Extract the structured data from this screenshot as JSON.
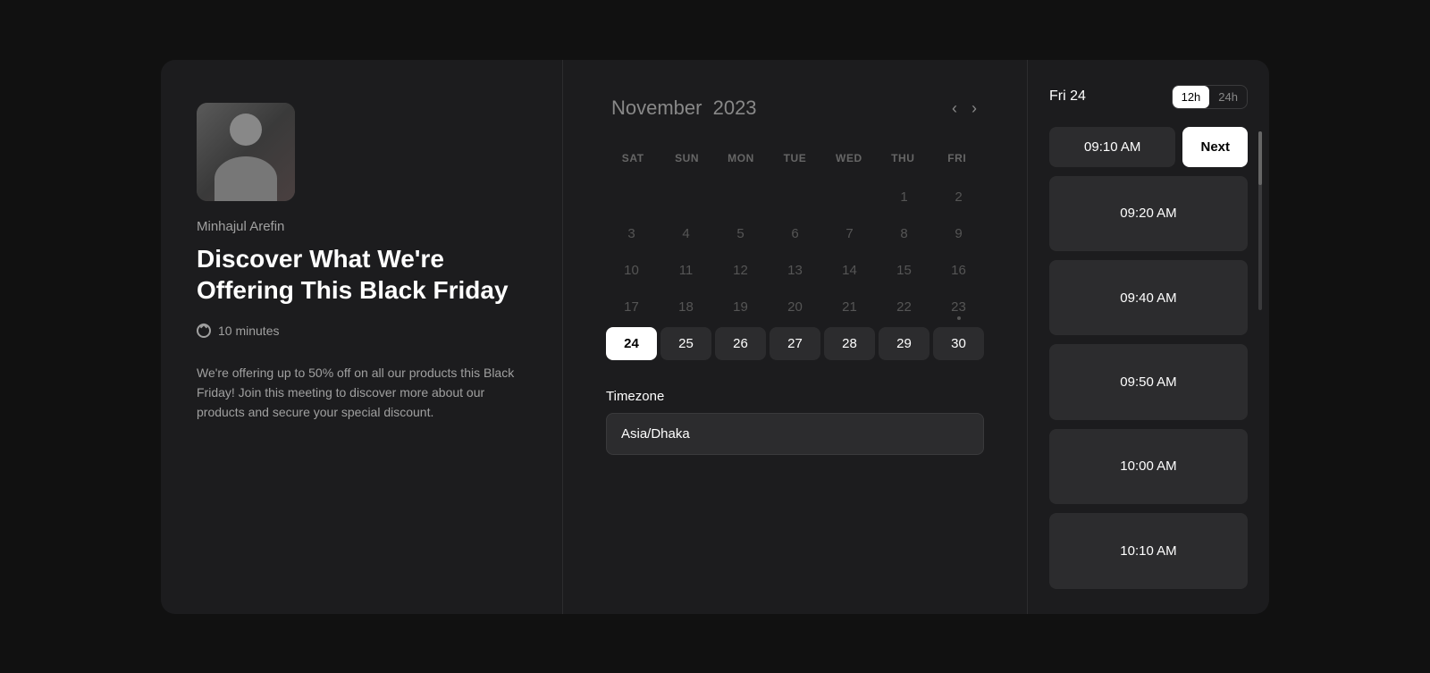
{
  "left": {
    "host_name": "Minhajul Arefin",
    "event_title_line1": "Discover What We're",
    "event_title_line2": "Offering This Black Friday",
    "duration": "10 minutes",
    "description": "We're offering up to 50% off on all our products this Black Friday! Join this meeting to discover more about our products and secure your special discount."
  },
  "calendar": {
    "month": "November",
    "year": "2023",
    "prev_label": "‹",
    "next_label": "›",
    "day_headers": [
      "SAT",
      "SUN",
      "MON",
      "TUE",
      "WED",
      "THU",
      "FRI"
    ],
    "timezone_label": "Timezone",
    "timezone_value": "Asia/Dhaka"
  },
  "time_panel": {
    "date_label": "Fri 24",
    "format_12h": "12h",
    "format_24h": "24h",
    "slots": [
      "09:10 AM",
      "09:20 AM",
      "09:40 AM",
      "09:50 AM",
      "10:00 AM",
      "10:10 AM"
    ],
    "next_button": "Next"
  }
}
